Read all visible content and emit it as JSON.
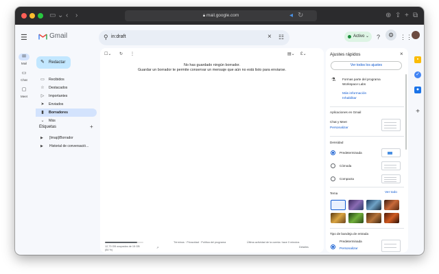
{
  "browser": {
    "url": "mail.google.com"
  },
  "header": {
    "app_name": "Gmail",
    "search_query": "in:draft",
    "status_label": "Activo"
  },
  "rail": {
    "items": [
      {
        "label": "Mail",
        "icon": "mail-icon"
      },
      {
        "label": "Chat",
        "icon": "chat-icon"
      },
      {
        "label": "Meet",
        "icon": "video-icon"
      }
    ]
  },
  "compose": {
    "label": "Redactar"
  },
  "nav": {
    "items": [
      {
        "label": "Recibidos",
        "icon": "inbox-icon",
        "active": false
      },
      {
        "label": "Destacados",
        "icon": "star-icon",
        "active": false
      },
      {
        "label": "Importantes",
        "icon": "important-icon",
        "active": false
      },
      {
        "label": "Enviados",
        "icon": "send-icon",
        "active": false
      },
      {
        "label": "Borradores",
        "icon": "draft-icon",
        "active": true
      },
      {
        "label": "Más",
        "icon": "chevron-down-icon",
        "active": false
      }
    ]
  },
  "labels": {
    "title": "Etiquetas",
    "items": [
      {
        "label": "[Imap]/Borrador"
      },
      {
        "label": "Historial de conversació..."
      }
    ]
  },
  "main": {
    "empty_title": "No has guardado ningún borrador.",
    "empty_subtitle": "Guardar un borrador te permite conservar un mensaje que aún no está listo para enviarse.",
    "storage": {
      "used_text": "12,73 GB ocupados de 15 GB",
      "percent_text": "(84 %)",
      "fraction": 0.84
    },
    "footer_links": "Términos · Privacidad · Política del programa",
    "activity_text": "Última actividad de la cuenta: hace 0 minutos",
    "details_link": "Detalles"
  },
  "quick_settings": {
    "title": "Ajustes rápidos",
    "all_settings": "Ver todos los ajustes",
    "program_line1": "Formas parte del programa",
    "program_line2": "Workspace Labs",
    "more_info": "Más información",
    "disable": "Inhabilitar",
    "apps_heading": "Aplicaciones en Gmail",
    "chat_meet": "Chat y Meet",
    "personalize": "Personalizar",
    "density_heading": "Densidad",
    "density_options": [
      {
        "label": "Predeterminada",
        "selected": true
      },
      {
        "label": "Cómoda",
        "selected": false
      },
      {
        "label": "Compacta",
        "selected": false
      }
    ],
    "theme_heading": "Tema",
    "theme_view_all": "Ver todo",
    "inbox_type_heading": "Tipo de bandeja de entrada",
    "inbox_default": "Predeterminada",
    "inbox_personalize": "Personalizar"
  },
  "colors": {
    "accent": "#0b57d0",
    "compose_bg": "#c2e7ff",
    "active_nav": "#d3e3fd",
    "status_bg": "#ddf4e4"
  }
}
